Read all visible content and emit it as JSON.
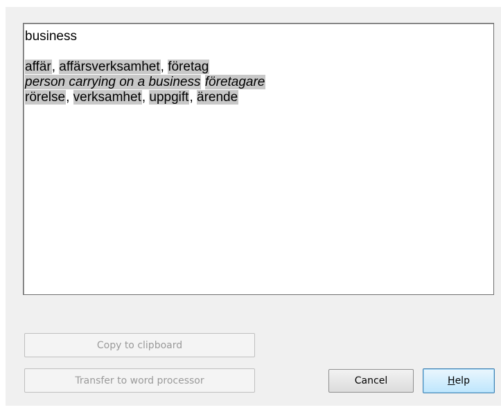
{
  "result": {
    "headword": "business",
    "lines": [
      [
        {
          "text": "affär",
          "hl": true
        },
        {
          "text": ", ",
          "hl": false
        },
        {
          "text": "affärsverksamhet",
          "hl": true
        },
        {
          "text": ", ",
          "hl": false
        },
        {
          "text": "företag",
          "hl": true
        }
      ],
      [
        {
          "text": "person carrying on a business",
          "hl": true,
          "italic": true
        },
        {
          "text": " ",
          "hl": false
        },
        {
          "text": "företagare",
          "hl": true,
          "italic": true
        }
      ],
      [
        {
          "text": "rörelse",
          "hl": true
        },
        {
          "text": ", ",
          "hl": false
        },
        {
          "text": "verksamhet",
          "hl": true
        },
        {
          "text": ", ",
          "hl": false
        },
        {
          "text": "uppgift",
          "hl": true
        },
        {
          "text": ", ",
          "hl": false
        },
        {
          "text": "ärende",
          "hl": true
        }
      ]
    ]
  },
  "buttons": {
    "copy_label": "Copy to clipboard",
    "transfer_label": "Transfer to word processor",
    "cancel_label": "Cancel",
    "help_mnemonic": "H",
    "help_rest": "elp"
  },
  "colors": {
    "highlight": "#c8c8c8",
    "dialog_background": "#f0f0f0",
    "default_button_border": "#3c7fb1"
  }
}
